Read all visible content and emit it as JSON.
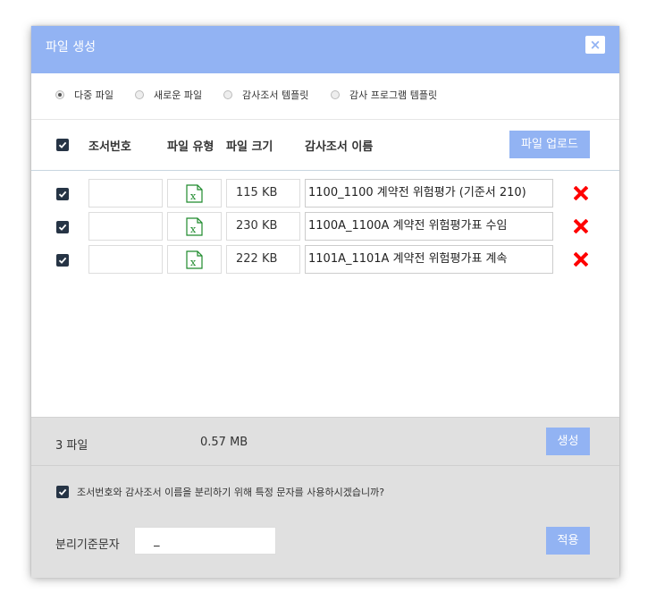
{
  "dialog": {
    "title": "파일 생성",
    "close_label": "×"
  },
  "mode_options": [
    {
      "label": "다중 파일",
      "selected": true
    },
    {
      "label": "새로운 파일",
      "selected": false
    },
    {
      "label": "감사조서 템플릿",
      "selected": false
    },
    {
      "label": "감사 프로그램 템플릿",
      "selected": false
    }
  ],
  "table": {
    "select_all_checked": true,
    "headers": {
      "number": "조서번호",
      "file_type": "파일 유형",
      "file_size": "파일 크기",
      "name": "감사조서 이름"
    },
    "upload_label": "파일 업로드",
    "rows": [
      {
        "checked": true,
        "number": "",
        "file_type_icon": "excel-icon",
        "size": "115 KB",
        "name": "1100_1100 계약전 위험평가 (기준서 210)"
      },
      {
        "checked": true,
        "number": "",
        "file_type_icon": "excel-icon",
        "size": "230 KB",
        "name": "1100A_1100A 계약전 위험평가표 수임"
      },
      {
        "checked": true,
        "number": "",
        "file_type_icon": "excel-icon",
        "size": "222 KB",
        "name": "1101A_1101A 계약전 위험평가표 계속"
      }
    ]
  },
  "summary": {
    "count_label": "3 파일",
    "total_size": "0.57 MB",
    "generate_label": "생성"
  },
  "separator_option": {
    "checked": true,
    "text": "조서번호와 감사조서 이름을 분리하기 위해 특정 문자를 사용하시겠습니까?",
    "label": "분리기준문자",
    "value": "_",
    "apply_label": "적용"
  },
  "colors": {
    "accent": "#92b3f3",
    "checkbox": "#263445",
    "delete": "#ff0000",
    "excel": "#1e8a2c",
    "footer_bg": "#e0e0e0"
  }
}
